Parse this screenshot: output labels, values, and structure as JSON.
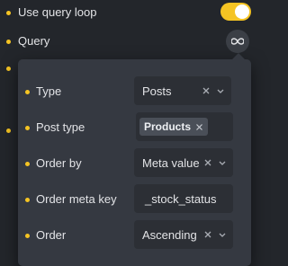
{
  "settings": {
    "use_query_loop": {
      "label": "Use query loop",
      "enabled": true
    },
    "query": {
      "label": "Query"
    }
  },
  "query_popover": {
    "type": {
      "label": "Type",
      "value": "Posts"
    },
    "post_type": {
      "label": "Post type",
      "tag": "Products"
    },
    "order_by": {
      "label": "Order by",
      "value": "Meta value"
    },
    "order_meta_key": {
      "label": "Order meta key",
      "value": "_stock_status"
    },
    "order": {
      "label": "Order",
      "value": "Ascending"
    }
  },
  "colors": {
    "accent": "#f5c423",
    "background": "#23262b",
    "panel": "#353941",
    "input": "#2c2f35"
  },
  "icons": [
    "infinity-link-icon",
    "clear-x-icon",
    "chevron-down-icon"
  ]
}
